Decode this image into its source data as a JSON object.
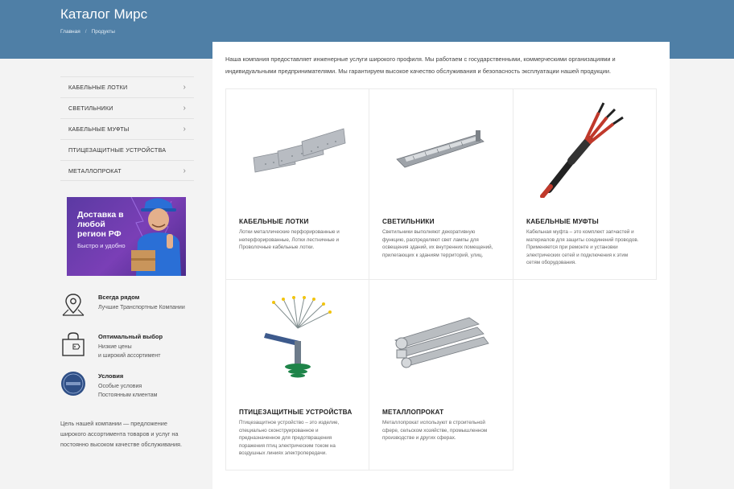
{
  "header": {
    "title": "Каталог Мирс",
    "breadcrumb": [
      "Главная",
      "Продукты"
    ]
  },
  "sidebar": {
    "menu": [
      {
        "label": "КАБЕЛЬНЫЕ ЛОТКИ",
        "has_submenu": true
      },
      {
        "label": "СВЕТИЛЬНИКИ",
        "has_submenu": true
      },
      {
        "label": "КАБЕЛЬНЫЕ МУФТЫ",
        "has_submenu": true
      },
      {
        "label": "ПТИЦЕЗАЩИТНЫЕ УСТРОЙСТВА",
        "has_submenu": false
      },
      {
        "label": "МЕТАЛЛОПРОКАТ",
        "has_submenu": true
      }
    ],
    "banner": {
      "title": "Доставка в любой регион РФ",
      "subtitle": "Быстро и удобно"
    },
    "features": [
      {
        "icon": "map-pin-icon",
        "title": "Всегда рядом",
        "text": "Лучшие Транспортные Компании"
      },
      {
        "icon": "shopping-bag-icon",
        "title": "Оптимальный выбор",
        "text": "Низкие цены\nи широкий ассортимент"
      },
      {
        "icon": "seal-icon",
        "title": "Условия",
        "text": "Особые условия\nПостоянным клиентам"
      }
    ],
    "mission": "Цель нашей компании — предложение широкого ассортимента товаров и услуг на постоянно высоком качестве обслуживания."
  },
  "main": {
    "intro": "Наша компания предоставляет инженерные услуги широкого профиля. Мы работаем с государственными, коммерческими организациями и индивидуальными предпринимателями. Мы гарантируем высокое качество обслуживания и безопасность эксплуатации нашей продукции.",
    "products": [
      {
        "title": "КАБЕЛЬНЫЕ ЛОТКИ",
        "description": "Лотки металлические перфорированные и неперфорированные, Лотки лестничные и Проволочные кабельные лотки."
      },
      {
        "title": "СВЕТИЛЬНИКИ",
        "description": "Светильники выполняют декоративную функцию, распределяют свет лампы для освещения зданий, их внутренних помещений, прилегающих к зданиям территорий, улиц."
      },
      {
        "title": "КАБЕЛЬНЫЕ МУФТЫ",
        "description": "Кабельная муфта – это комплект запчастей и материалов для защиты соединений проводов. Применяется при ремонте и установки электрических сетей и подключения к этим сетям оборудования."
      },
      {
        "title": "ПТИЦЕЗАЩИТНЫЕ УСТРОЙСТВА",
        "description": "Птицезащитное устройство – это изделие, специально сконструированное и предназначенное для предотвращения поражения птиц электрическим током на воздушных линиях электропередачи."
      },
      {
        "title": "МЕТАЛЛОПРОКАТ",
        "description": "Металлопрокат используют в строительной сфере, сельском хозяйстве, промышленном производстве и других сферах."
      }
    ]
  },
  "colors": {
    "header_bg": "#4f7fa6",
    "page_bg": "#f3f3f3",
    "banner_bg": "#6a3aae",
    "banner_accent": "#2a6fd6"
  }
}
